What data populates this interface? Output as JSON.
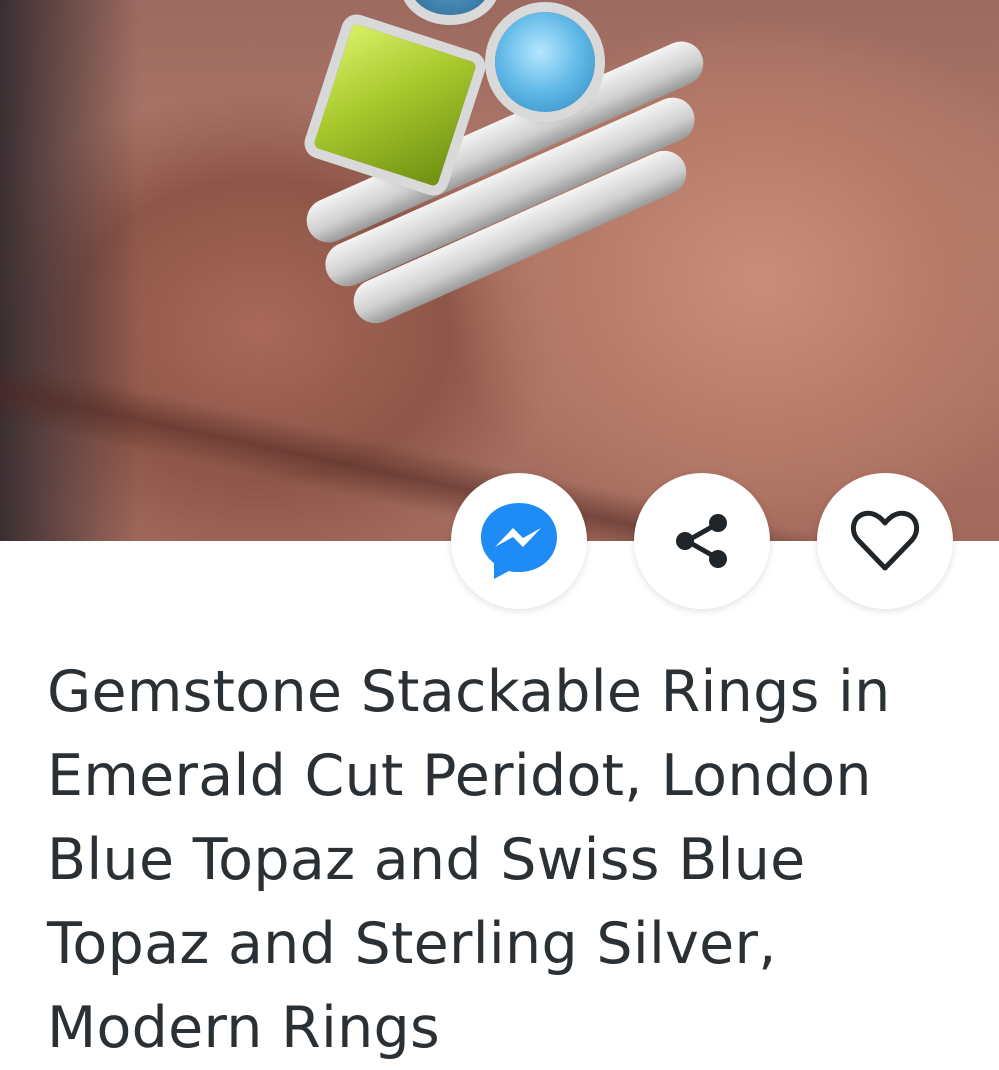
{
  "product": {
    "image_alt": "Gemstone stackable rings on a finger",
    "title": "Gemstone Stackable Rings in Emerald Cut Peridot, London Blue Topaz and Swiss Blue Topaz and Sterling Silver, Modern Rings"
  },
  "actions": [
    {
      "name": "messenger",
      "icon": "messenger-icon",
      "color": "#1f8cf6"
    },
    {
      "name": "share",
      "icon": "share-icon",
      "color": "#1f2528"
    },
    {
      "name": "favorite",
      "icon": "heart-icon",
      "color": "#1f2528"
    }
  ],
  "colors": {
    "title_text": "#2a3034",
    "background": "#ffffff",
    "messenger_blue": "#1f8cf6"
  }
}
